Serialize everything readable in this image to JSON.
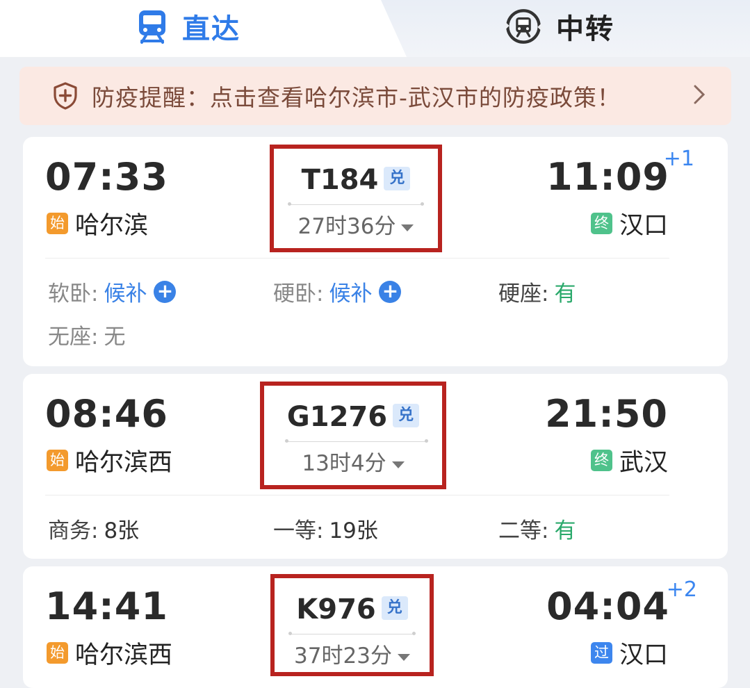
{
  "tabs": {
    "direct": {
      "label": "直达",
      "icon": "train-front-icon"
    },
    "transfer": {
      "label": "中转",
      "icon": "transfer-train-icon"
    }
  },
  "notice": {
    "text": "防疫提醒：点击查看哈尔滨市-武汉市的防疫政策！",
    "icon": "shield-plus-icon",
    "arrow": "chevron-right-icon"
  },
  "colors": {
    "accent_blue": "#2f7be8",
    "highlight_red": "#b8231f",
    "available_green": "#2aa96b",
    "start_badge": "#f39a2d",
    "end_badge": "#4fc28b",
    "pass_badge": "#3d86ee"
  },
  "trains": [
    {
      "dep_time": "07:33",
      "dep_badge": "始",
      "dep_station": "哈尔滨",
      "code": "T184",
      "exchange": "兑",
      "duration": "27时36分",
      "arr_time": "11:09",
      "arr_day": "+1",
      "arr_badge": "终",
      "arr_station": "汉口",
      "seats": [
        {
          "label": "软卧:",
          "value": "候补"
        },
        {
          "label": "硬卧:",
          "value": "候补"
        },
        {
          "label": "硬座:",
          "value": "有"
        },
        {
          "label": "无座:",
          "value": "无"
        }
      ]
    },
    {
      "dep_time": "08:46",
      "dep_badge": "始",
      "dep_station": "哈尔滨西",
      "code": "G1276",
      "exchange": "兑",
      "duration": "13时4分",
      "arr_time": "21:50",
      "arr_day": "",
      "arr_badge": "终",
      "arr_station": "武汉",
      "seats": [
        {
          "label": "商务:",
          "value": "8张"
        },
        {
          "label": "一等:",
          "value": "19张"
        },
        {
          "label": "二等:",
          "value": "有"
        }
      ]
    },
    {
      "dep_time": "14:41",
      "dep_badge": "始",
      "dep_station": "哈尔滨西",
      "code": "K976",
      "exchange": "兑",
      "duration": "37时23分",
      "arr_time": "04:04",
      "arr_day": "+2",
      "arr_badge": "过",
      "arr_station": "汉口",
      "seats": []
    }
  ]
}
